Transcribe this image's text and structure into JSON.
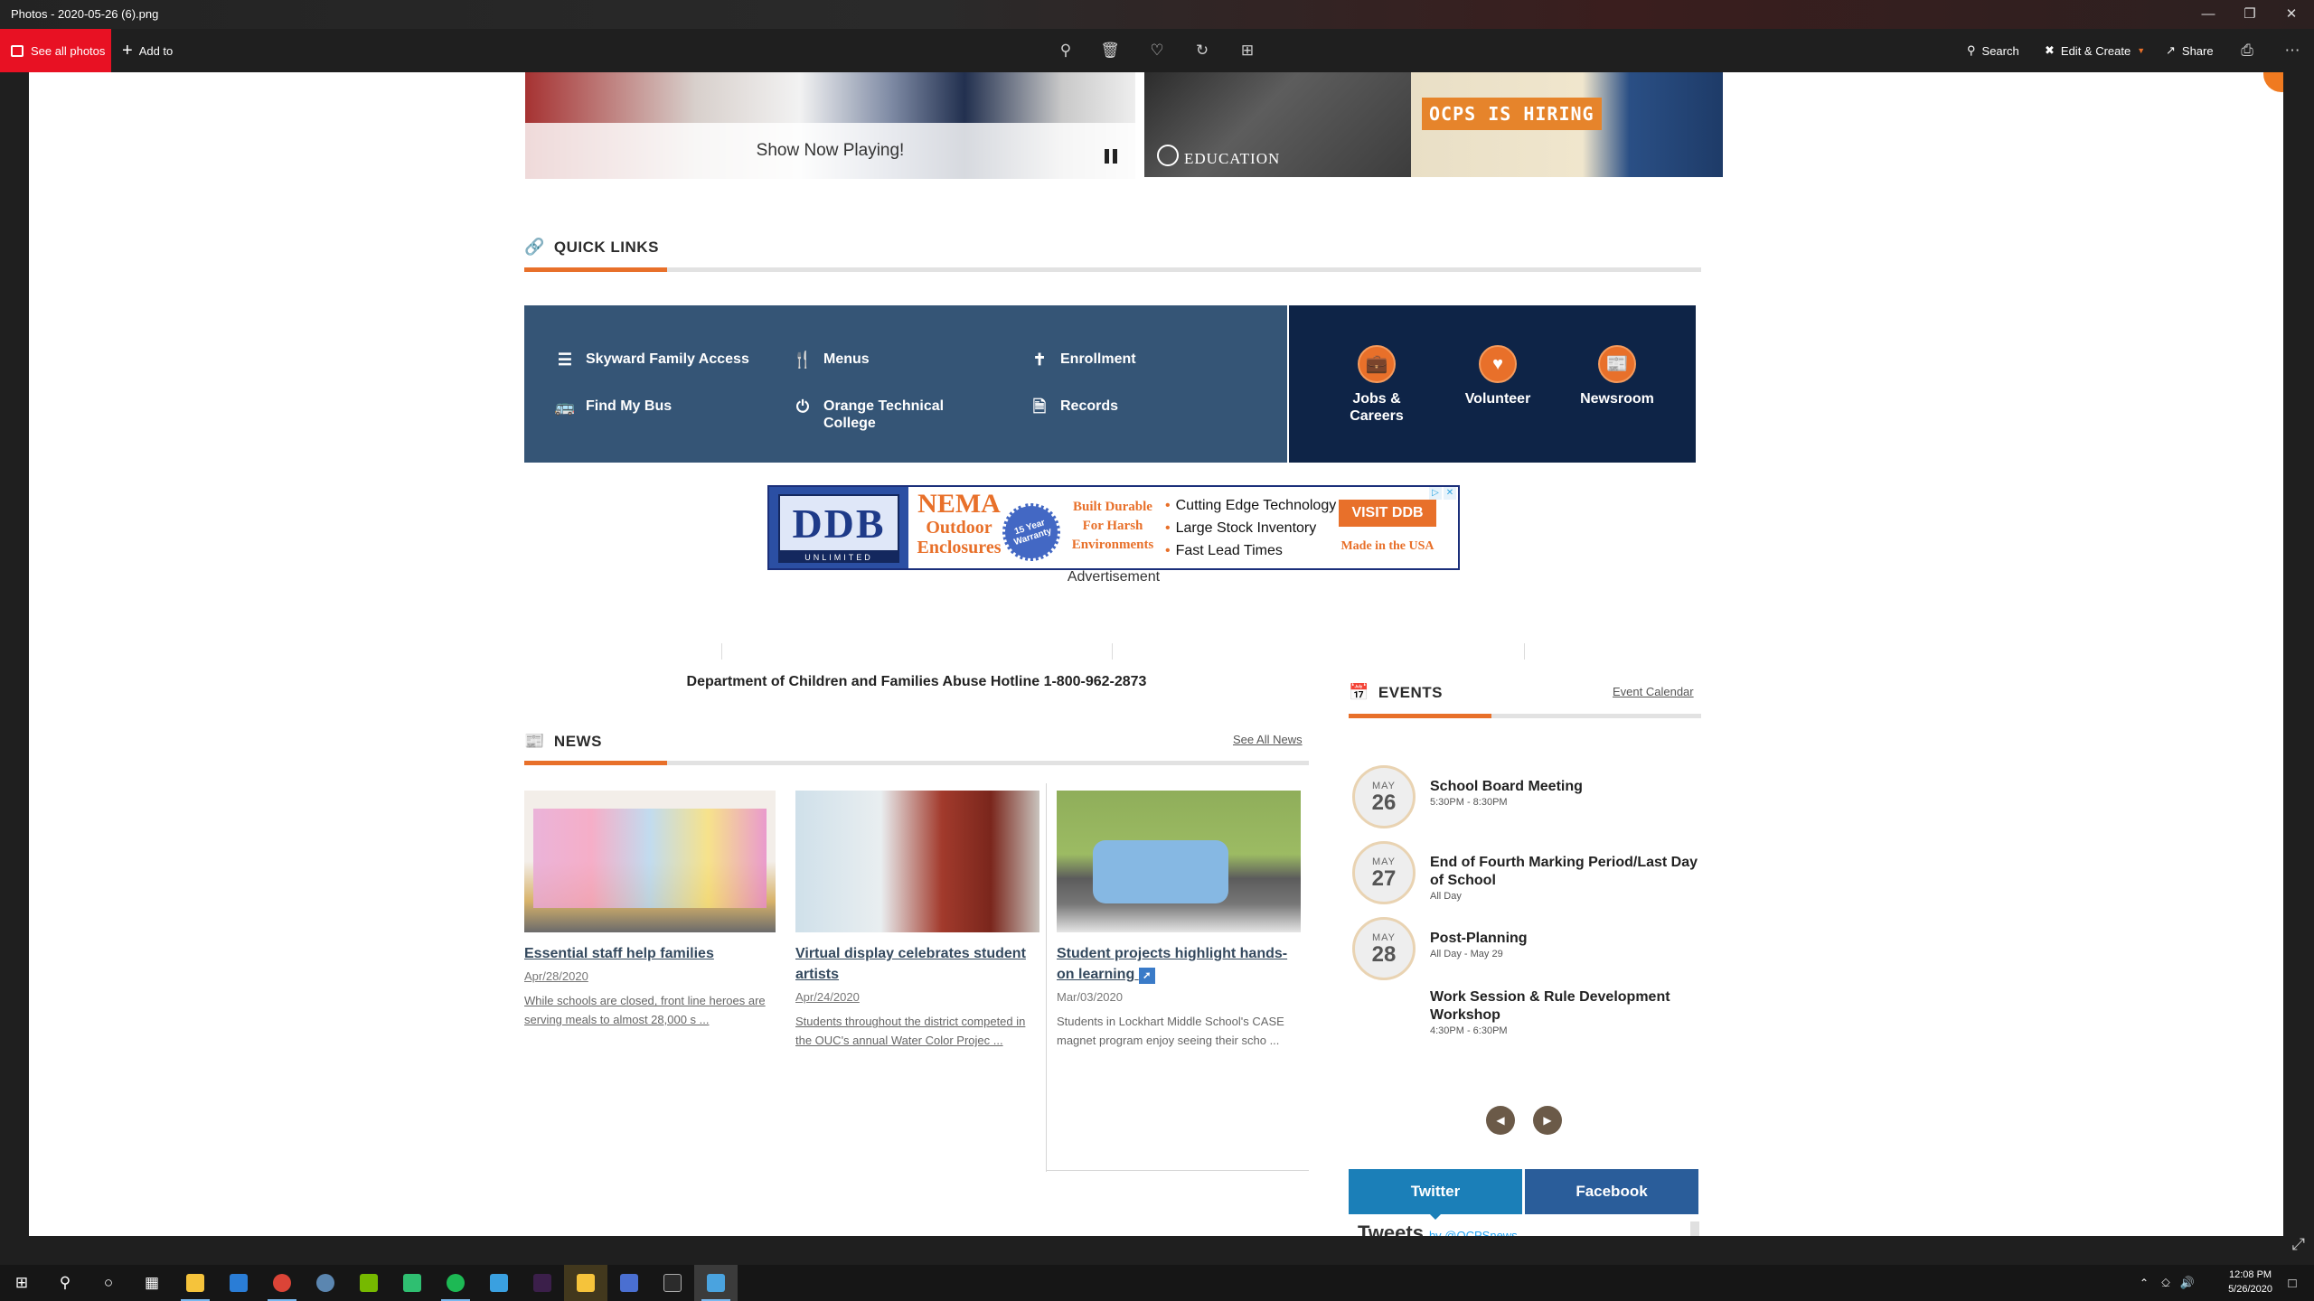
{
  "titlebar": {
    "title": "Photos - 2020-05-26 (6).png"
  },
  "apptoolbar": {
    "see_all": "See all photos",
    "add_to": "Add to",
    "search": "Search",
    "edit_create": "Edit & Create",
    "share": "Share"
  },
  "carousel": {
    "caption": "Show Now Playing!",
    "edu_text": "EDUCATION",
    "hiring_text": "OCPS IS HIRING"
  },
  "quick_links": {
    "heading": "QUICK LINKS",
    "items": [
      {
        "label": "Skyward Family Access",
        "icon": "list-icon"
      },
      {
        "label": "Menus",
        "icon": "utensils-icon"
      },
      {
        "label": "Enrollment",
        "icon": "person-icon"
      },
      {
        "label": "Find My Bus",
        "icon": "bus-icon"
      },
      {
        "label": "Orange Technical College",
        "icon": "power-icon"
      },
      {
        "label": "Records",
        "icon": "document-icon"
      }
    ],
    "featured": [
      {
        "label": "Jobs & Careers",
        "icon": "briefcase-icon"
      },
      {
        "label": "Volunteer",
        "icon": "heart-icon"
      },
      {
        "label": "Newsroom",
        "icon": "newspaper-icon"
      }
    ]
  },
  "ad": {
    "logo": "DDB",
    "logo_sub": "UNLIMITED",
    "nema_1": "NEMA",
    "nema_2": "Outdoor",
    "nema_3": "Enclosures",
    "warranty": "15 Year Warranty",
    "built_1": "Built Durable",
    "built_2": "For Harsh",
    "built_3": "Environments",
    "bullets": [
      "Cutting Edge Technology",
      "Large Stock Inventory",
      "Fast Lead Times"
    ],
    "visit": "VISIT DDB",
    "made": "Made in the USA",
    "label": "Advertisement"
  },
  "hotline": "Department of Children and Families Abuse Hotline 1-800-962-2873",
  "news": {
    "heading": "NEWS",
    "see_all": "See All News",
    "items": [
      {
        "title": "Essential staff help families",
        "date": "Apr/28/2020",
        "summary": "While schools are closed, front line heroes are serving meals to almost 28,000 s ..."
      },
      {
        "title": "Virtual display celebrates student artists",
        "date": "Apr/24/2020",
        "summary": "Students throughout the district competed in the OUC's annual Water Color Projec ..."
      },
      {
        "title": "Student projects highlight hands-on learning",
        "date": "Mar/03/2020",
        "summary": "Students in Lockhart Middle School's CASE magnet program enjoy seeing their scho ..."
      }
    ]
  },
  "events": {
    "heading": "EVENTS",
    "calendar": "Event Calendar",
    "items": [
      {
        "month": "MAY",
        "day": "26",
        "name": "School Board Meeting",
        "time": "5:30PM - 8:30PM"
      },
      {
        "month": "MAY",
        "day": "27",
        "name": "End of Fourth Marking Period/Last Day of School",
        "time": "All Day"
      },
      {
        "month": "MAY",
        "day": "28",
        "name": "Post-Planning",
        "time": "All Day - May 29"
      },
      {
        "month": "",
        "day": "",
        "name": "Work Session & Rule Development Workshop",
        "time": "4:30PM - 6:30PM"
      }
    ]
  },
  "social": {
    "twitter": "Twitter",
    "facebook": "Facebook",
    "tweets": "Tweets",
    "tweets_by": "by @OCPSnews"
  },
  "taskbar": {
    "time": "12:08 PM",
    "date": "5/26/2020"
  },
  "colors": {
    "accent_orange": "#e8702a",
    "ql_blue": "#355576",
    "ql_navy": "#0e2447",
    "photos_red": "#e81123",
    "twitter_blue": "#1b7fb8",
    "facebook_blue": "#2a5d9a"
  }
}
